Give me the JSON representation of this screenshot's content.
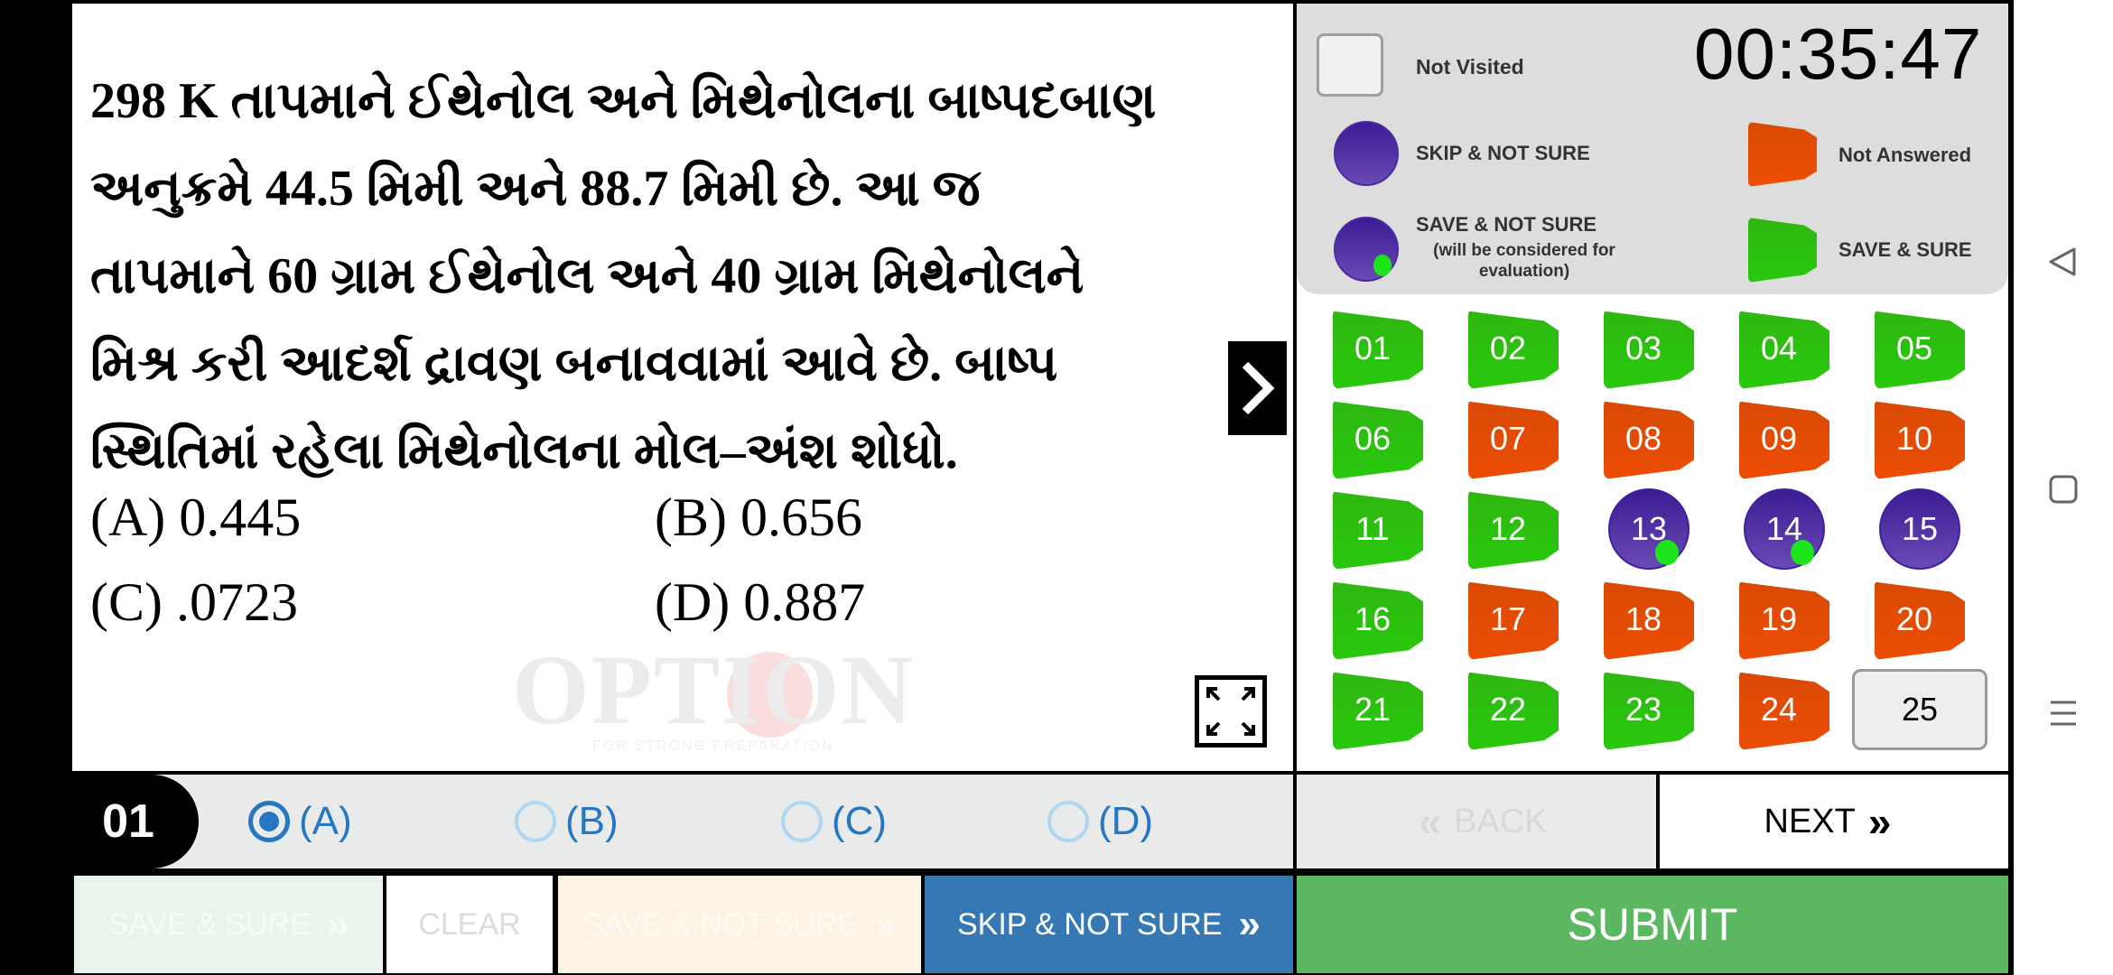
{
  "question": {
    "number": "01",
    "lines": [
      "298 K તાપમાને ઈથેનોલ અને મિથેનોલના બાષ્પદબાણ",
      "અનુક્રમે 44.5 મિમી અને 88.7 મિમી છે. આ જ",
      "તાપમાને 60 ગ્રામ ઈથેનોલ અને 40 ગ્રામ મિથેનોલને",
      "મિશ્ર કરી આદર્શ દ્રાવણ બનાવવામાં આવે છે. બાષ્પ",
      "સ્થિતિમાં રહેલા મિથેનોલના મોલ–અંશ શોધો."
    ],
    "options": [
      {
        "label": "(A) 0.445"
      },
      {
        "label": "(B) 0.656"
      },
      {
        "label": "(C) .0723"
      },
      {
        "label": "(D) 0.887"
      }
    ]
  },
  "watermark": {
    "title": "OPTION",
    "subtitle": "FOR STRONG PREPARATION"
  },
  "answer": {
    "choices": [
      {
        "label": "(A)",
        "selected": true
      },
      {
        "label": "(B)",
        "selected": false
      },
      {
        "label": "(C)",
        "selected": false
      },
      {
        "label": "(D)",
        "selected": false
      }
    ]
  },
  "actions": {
    "save_sure": "SAVE & SURE",
    "clear": "CLEAR",
    "save_not_sure": "SAVE & NOT SURE",
    "skip_not_sure": "SKIP & NOT SURE",
    "chevron": "»",
    "back": "BACK",
    "back_chevron": "«",
    "next": "NEXT",
    "submit": "SUBMIT"
  },
  "legend": {
    "not_visited": "Not Visited",
    "skip_not_sure": "SKIP & NOT SURE",
    "not_answered": "Not Answered",
    "save_not_sure": "SAVE & NOT SURE",
    "save_not_sure_note": "(will be considered for evaluation)",
    "save_sure": "SAVE & SURE"
  },
  "timer": "00:35:47",
  "colors": {
    "save_sure": "#2bc20e",
    "not_answered": "#e84c05",
    "skip_not_sure": "#4a2ca0",
    "not_visited": "#eeeeee",
    "accent_blue": "#3578b4",
    "submit_green": "#5cb860",
    "radio_blue": "#2677c2"
  },
  "questions_grid": [
    {
      "n": "01",
      "status": "save_sure"
    },
    {
      "n": "02",
      "status": "save_sure"
    },
    {
      "n": "03",
      "status": "save_sure"
    },
    {
      "n": "04",
      "status": "save_sure"
    },
    {
      "n": "05",
      "status": "save_sure"
    },
    {
      "n": "06",
      "status": "save_sure"
    },
    {
      "n": "07",
      "status": "not_answered"
    },
    {
      "n": "08",
      "status": "not_answered"
    },
    {
      "n": "09",
      "status": "not_answered"
    },
    {
      "n": "10",
      "status": "not_answered"
    },
    {
      "n": "11",
      "status": "save_sure"
    },
    {
      "n": "12",
      "status": "save_sure"
    },
    {
      "n": "13",
      "status": "save_not_sure"
    },
    {
      "n": "14",
      "status": "save_not_sure"
    },
    {
      "n": "15",
      "status": "skip_not_sure"
    },
    {
      "n": "16",
      "status": "save_sure"
    },
    {
      "n": "17",
      "status": "not_answered"
    },
    {
      "n": "18",
      "status": "not_answered"
    },
    {
      "n": "19",
      "status": "not_answered"
    },
    {
      "n": "20",
      "status": "not_answered"
    },
    {
      "n": "21",
      "status": "save_sure"
    },
    {
      "n": "22",
      "status": "save_sure"
    },
    {
      "n": "23",
      "status": "save_sure"
    },
    {
      "n": "24",
      "status": "not_answered"
    },
    {
      "n": "25",
      "status": "not_visited"
    }
  ],
  "system_nav": {
    "back_icon": "triangle-back",
    "home_icon": "square-home",
    "menu_icon": "three-lines-menu"
  }
}
